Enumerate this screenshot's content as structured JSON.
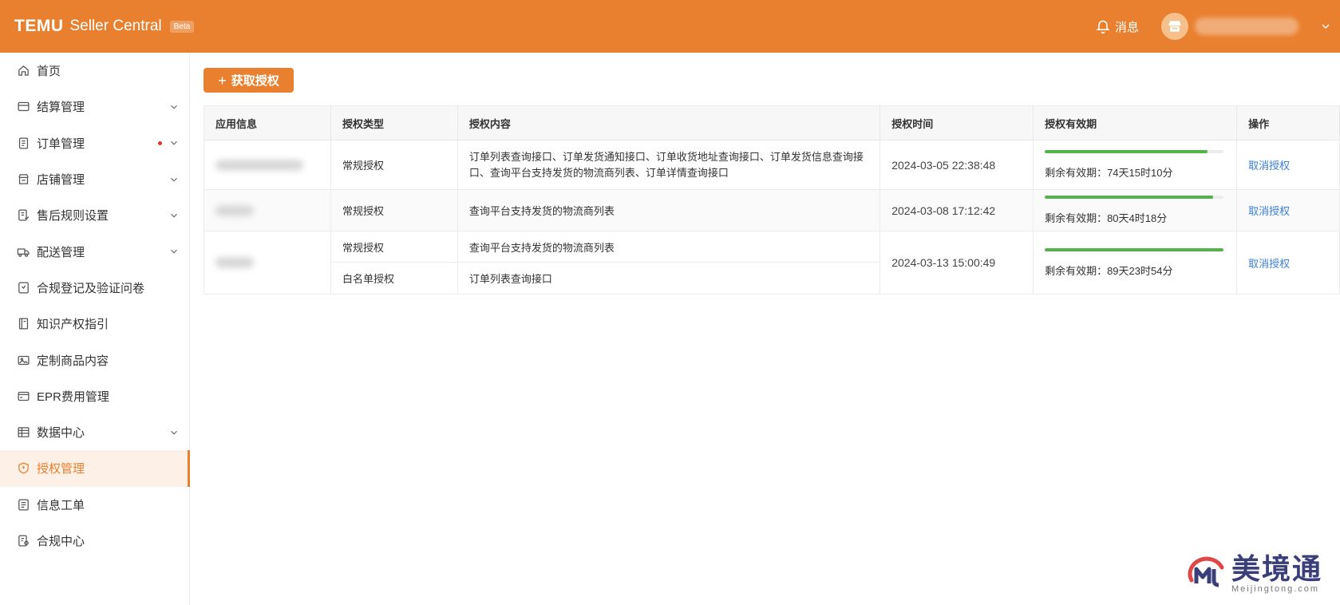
{
  "header": {
    "logo": "TEMU",
    "app_name": "Seller Central",
    "badge": "Beta",
    "messages_label": "消息"
  },
  "sidebar": {
    "items": [
      {
        "label": "首页",
        "icon": "home-icon",
        "has_chevron": false,
        "active": false
      },
      {
        "label": "结算管理",
        "icon": "wallet-icon",
        "has_chevron": true,
        "active": false
      },
      {
        "label": "订单管理",
        "icon": "order-icon",
        "has_chevron": true,
        "active": false,
        "has_dot": true
      },
      {
        "label": "店铺管理",
        "icon": "shop-icon",
        "has_chevron": true,
        "active": false
      },
      {
        "label": "售后规则设置",
        "icon": "after-sales-icon",
        "has_chevron": true,
        "active": false
      },
      {
        "label": "配送管理",
        "icon": "truck-icon",
        "has_chevron": true,
        "active": false
      },
      {
        "label": "合规登记及验证问卷",
        "icon": "compliance-form-icon",
        "has_chevron": false,
        "active": false
      },
      {
        "label": "知识产权指引",
        "icon": "book-icon",
        "has_chevron": false,
        "active": false
      },
      {
        "label": "定制商品内容",
        "icon": "image-icon",
        "has_chevron": false,
        "active": false
      },
      {
        "label": "EPR费用管理",
        "icon": "card-icon",
        "has_chevron": false,
        "active": false
      },
      {
        "label": "数据中心",
        "icon": "data-icon",
        "has_chevron": true,
        "active": false
      },
      {
        "label": "授权管理",
        "icon": "shield-icon",
        "has_chevron": false,
        "active": true
      },
      {
        "label": "信息工单",
        "icon": "ticket-icon",
        "has_chevron": false,
        "active": false
      },
      {
        "label": "合规中心",
        "icon": "compliance-center-icon",
        "has_chevron": false,
        "active": false
      }
    ]
  },
  "main": {
    "add_button": "获取授权",
    "table": {
      "headers": [
        "应用信息",
        "授权类型",
        "授权内容",
        "授权时间",
        "授权有效期",
        "操作"
      ],
      "rows": [
        {
          "types": [
            "常规授权"
          ],
          "contents": [
            "订单列表查询接口、订单发货通知接口、订单收货地址查询接口、订单发货信息查询接口、查询平台支持发货的物流商列表、订单详情查询接口"
          ],
          "time": "2024-03-05 22:38:48",
          "progress": 0.91,
          "remaining": "剩余有效期：74天15时10分",
          "action": "取消授权"
        },
        {
          "types": [
            "常规授权"
          ],
          "contents": [
            "查询平台支持发货的物流商列表"
          ],
          "time": "2024-03-08 17:12:42",
          "progress": 0.94,
          "remaining": "剩余有效期：80天4时18分",
          "action": "取消授权"
        },
        {
          "types": [
            "常规授权",
            "白名单授权"
          ],
          "contents": [
            "查询平台支持发货的物流商列表",
            "订单列表查询接口"
          ],
          "time": "2024-03-13 15:00:49",
          "progress": 1.0,
          "remaining": "剩余有效期：89天23时54分",
          "action": "取消授权"
        }
      ]
    }
  },
  "watermark": {
    "title": "美境通",
    "subtitle": "Meijingtong.com"
  },
  "colors": {
    "brand": "#e9802f",
    "progress": "#52b34a",
    "link": "#3b7fd9"
  }
}
